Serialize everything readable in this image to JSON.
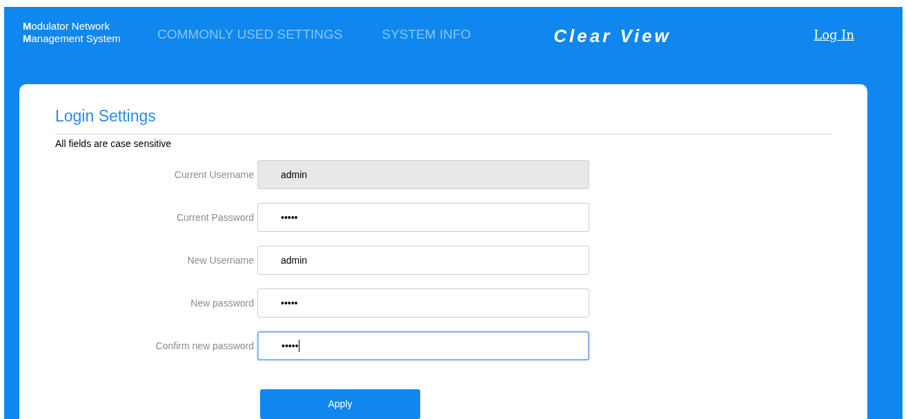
{
  "header": {
    "brand_lines": [
      "**M**odulator Network",
      "**M**anagement System"
    ],
    "nav": [
      "COMMONLY USED SETTINGS",
      "SYSTEM INFO"
    ],
    "logo": "Clear View",
    "login_link": "Log In"
  },
  "form": {
    "title": "Login Settings",
    "note": "All fields are case sensitive",
    "fields": [
      {
        "label": "Current Username",
        "value": "admin",
        "kind": "readonly",
        "focused": false
      },
      {
        "label": "Current Password",
        "value": "•••••",
        "kind": "password",
        "focused": false
      },
      {
        "label": "New Username",
        "value": "admin",
        "kind": "text",
        "focused": false
      },
      {
        "label": "New password",
        "value": "•••••",
        "kind": "password",
        "focused": false
      },
      {
        "label": "Confirm new password",
        "value": "•••••",
        "kind": "password",
        "focused": true
      }
    ],
    "button": "Apply"
  }
}
